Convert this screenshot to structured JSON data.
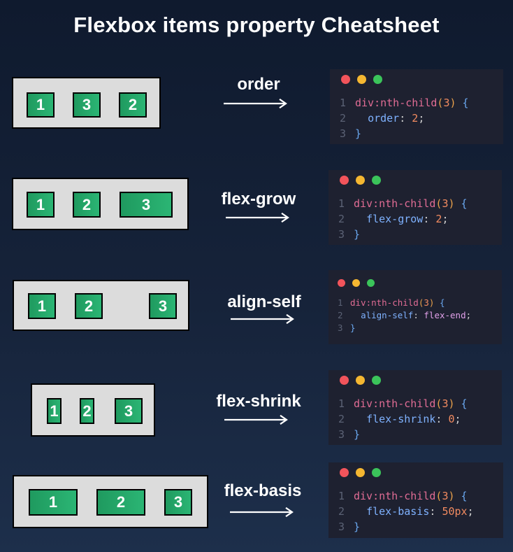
{
  "title": "Flexbox items property Cheatsheet",
  "colors": {
    "dot_red": "#f2545b",
    "dot_yellow": "#f5b731",
    "dot_green": "#3bc45a",
    "item_green": "#22a866",
    "demo_bg": "#dcdcdc"
  },
  "sections": [
    {
      "property": "order",
      "items": [
        "1",
        "3",
        "2"
      ],
      "code": {
        "ln1": "1",
        "ln2": "2",
        "ln3": "3",
        "selector": "div:nth-child",
        "arg": "3",
        "open": " {",
        "prop": "order",
        "value": "2",
        "close": "}"
      }
    },
    {
      "property": "flex-grow",
      "items": [
        "1",
        "2",
        "3"
      ],
      "code": {
        "ln1": "1",
        "ln2": "2",
        "ln3": "3",
        "selector": "div:nth-child",
        "arg": "3",
        "open": " {",
        "prop": "flex-grow",
        "value": "2",
        "close": "}"
      }
    },
    {
      "property": "align-self",
      "items": [
        "1",
        "2",
        "3"
      ],
      "code": {
        "ln1": "1",
        "ln2": "2",
        "ln3": "3",
        "selector": "div:nth-child",
        "arg": "3",
        "open": " {",
        "prop": "align-self",
        "value": "flex-end",
        "close": "}"
      }
    },
    {
      "property": "flex-shrink",
      "items": [
        "1",
        "2",
        "3"
      ],
      "code": {
        "ln1": "1",
        "ln2": "2",
        "ln3": "3",
        "selector": "div:nth-child",
        "arg": "3",
        "open": " {",
        "prop": "flex-shrink",
        "value": "0",
        "close": "}"
      }
    },
    {
      "property": "flex-basis",
      "items": [
        "1",
        "2",
        "3"
      ],
      "code": {
        "ln1": "1",
        "ln2": "2",
        "ln3": "3",
        "selector": "div:nth-child",
        "arg": "3",
        "open": " {",
        "prop": "flex-basis",
        "value": "50px",
        "close": "}"
      }
    }
  ]
}
